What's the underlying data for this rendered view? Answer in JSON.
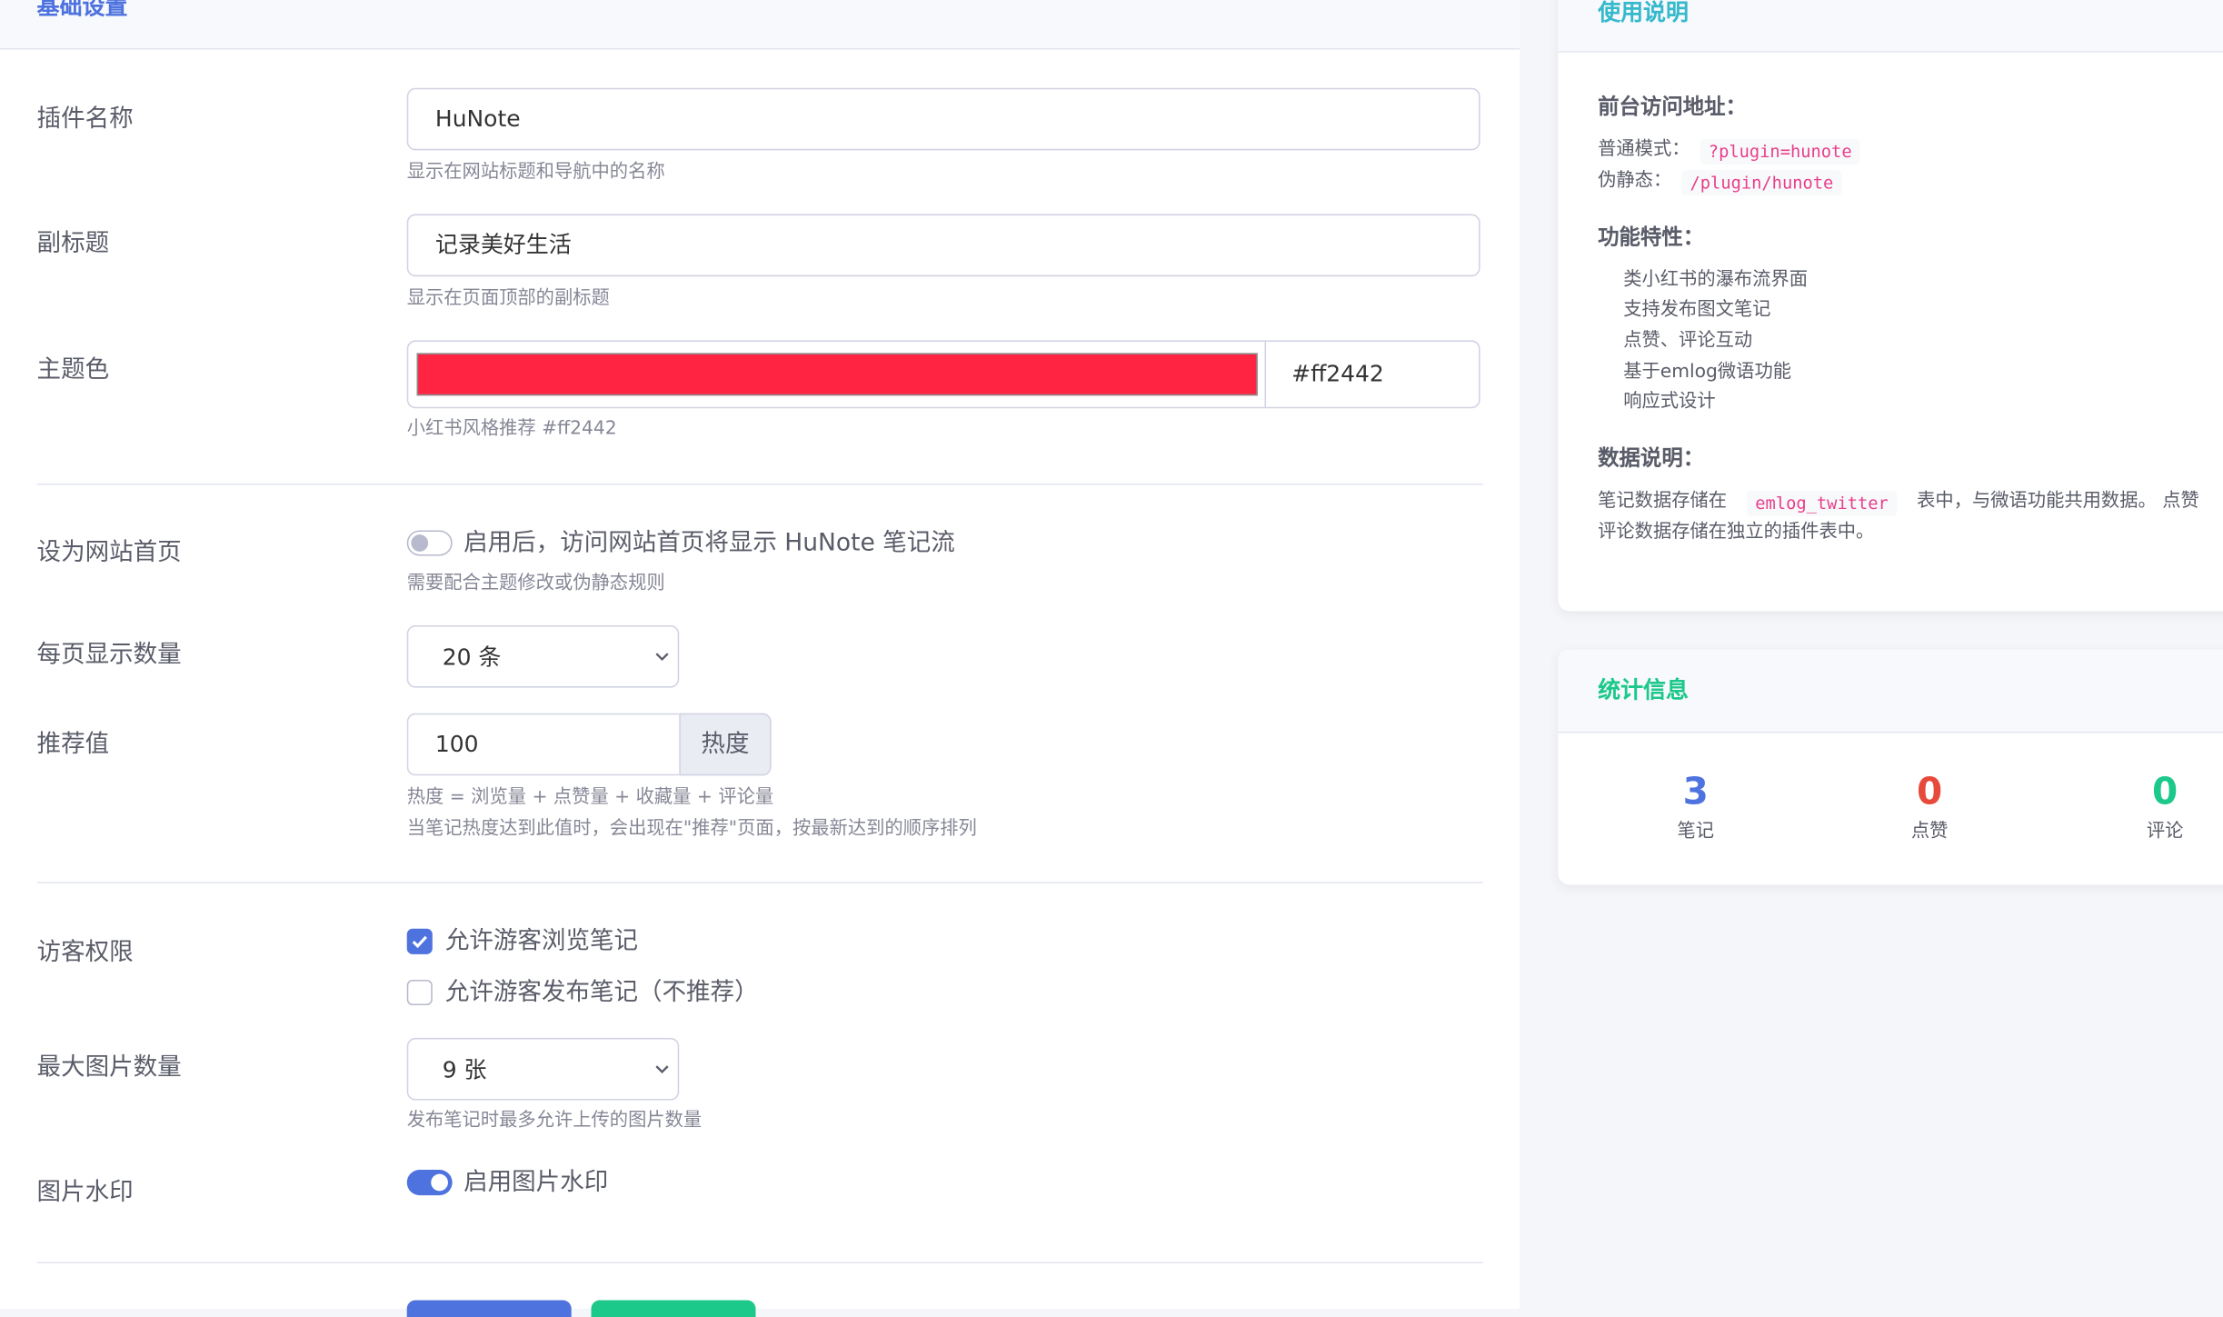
{
  "main": {
    "header_title": "基础设置",
    "plugin_name": {
      "label": "插件名称",
      "value": "HuNote",
      "help": "显示在网站标题和导航中的名称"
    },
    "subtitle": {
      "label": "副标题",
      "value": "记录美好生活",
      "help": "显示在页面顶部的副标题"
    },
    "theme_color": {
      "label": "主题色",
      "color": "#ff2442",
      "value": "#ff2442",
      "help": "小红书风格推荐 #ff2442"
    },
    "homepage": {
      "label": "设为网站首页",
      "switch_label": "启用后，访问网站首页将显示 HuNote 笔记流",
      "enabled": false,
      "help": "需要配合主题修改或伪静态规则"
    },
    "per_page": {
      "label": "每页显示数量",
      "value": "20 条"
    },
    "recommend": {
      "label": "推荐值",
      "value": "100",
      "addon": "热度",
      "help1": "热度 = 浏览量 + 点赞量 + 收藏量 + 评论量",
      "help2": "当笔记热度达到此值时，会出现在\"推荐\"页面，按最新达到的顺序排列"
    },
    "guest": {
      "label": "访客权限",
      "opt1": "允许游客浏览笔记",
      "opt1_checked": true,
      "opt2": "允许游客发布笔记（不推荐）",
      "opt2_checked": false
    },
    "max_images": {
      "label": "最大图片数量",
      "value": "9 张",
      "help": "发布笔记时最多允许上传的图片数量"
    },
    "watermark": {
      "label": "图片水印",
      "switch_label": "启用图片水印",
      "enabled": true
    },
    "colors": {
      "primary": "#4e73df",
      "success": "#1cc88a",
      "danger": "#e74a3b"
    }
  },
  "usage": {
    "title": "使用说明",
    "access_heading": "前台访问地址：",
    "normal_label": "普通模式：",
    "normal_code": "?plugin=hunote",
    "rewrite_label": "伪静态：",
    "rewrite_code": "/plugin/hunote",
    "features_heading": "功能特性：",
    "features": [
      "类小红书的瀑布流界面",
      "支持发布图文笔记",
      "点赞、评论互动",
      "基于emlog微语功能",
      "响应式设计"
    ],
    "data_heading": "数据说明：",
    "data_text_1": "笔记数据存储在",
    "data_code": "emlog_twitter",
    "data_text_2": "表中，与微语功能共用数据。 点赞",
    "data_text_3": "评论数据存储在独立的插件表中。"
  },
  "stats": {
    "title": "统计信息",
    "items": [
      {
        "value": "3",
        "label": "笔记"
      },
      {
        "value": "0",
        "label": "点赞"
      },
      {
        "value": "0",
        "label": "评论"
      }
    ]
  }
}
